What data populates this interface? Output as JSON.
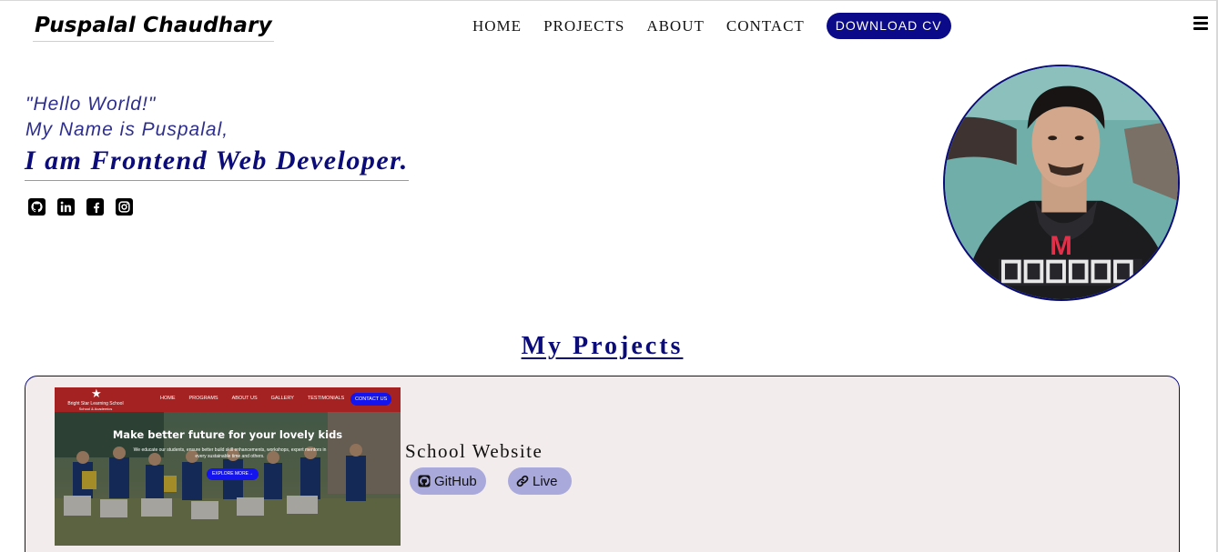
{
  "header": {
    "brand": "Puspalal Chaudhary",
    "nav": [
      "HOME",
      "PROJECTS",
      "ABOUT",
      "CONTACT"
    ],
    "cta": "DOWNLOAD CV",
    "menu_icon": "hamburger-icon"
  },
  "hero": {
    "greeting": "\"Hello World!\"",
    "name_line": "My Name is Puspalal,",
    "role_line": "I am Frontend Web Developer.",
    "socials": [
      "github-icon",
      "linkedin-icon",
      "facebook-icon",
      "instagram-icon"
    ],
    "avatar_text": "M"
  },
  "projects": {
    "heading": "My Projects",
    "items": [
      {
        "name": "School Website",
        "links": {
          "github": "GitHub",
          "live": "Live"
        },
        "preview": {
          "school_line1": "Bright Star Learning School",
          "school_line2": "School & Academics",
          "menu": [
            "HOME",
            "PROGRAMS",
            "ABOUT US",
            "GALLERY",
            "TESTIMONIALS"
          ],
          "contact": "CONTACT US",
          "headline": "Make better future for your lovely kids",
          "subtext": "We educate our students, ensure better build skill enhancements, workshops, expert mentors in every sustainable time and others.",
          "button": "EXPLORE MORE→"
        }
      }
    ]
  },
  "colors": {
    "accent": "#0b0b8a",
    "card_bg": "#f3ecec",
    "pill_bg": "#a9a9db",
    "preview_nav": "#a52222"
  }
}
